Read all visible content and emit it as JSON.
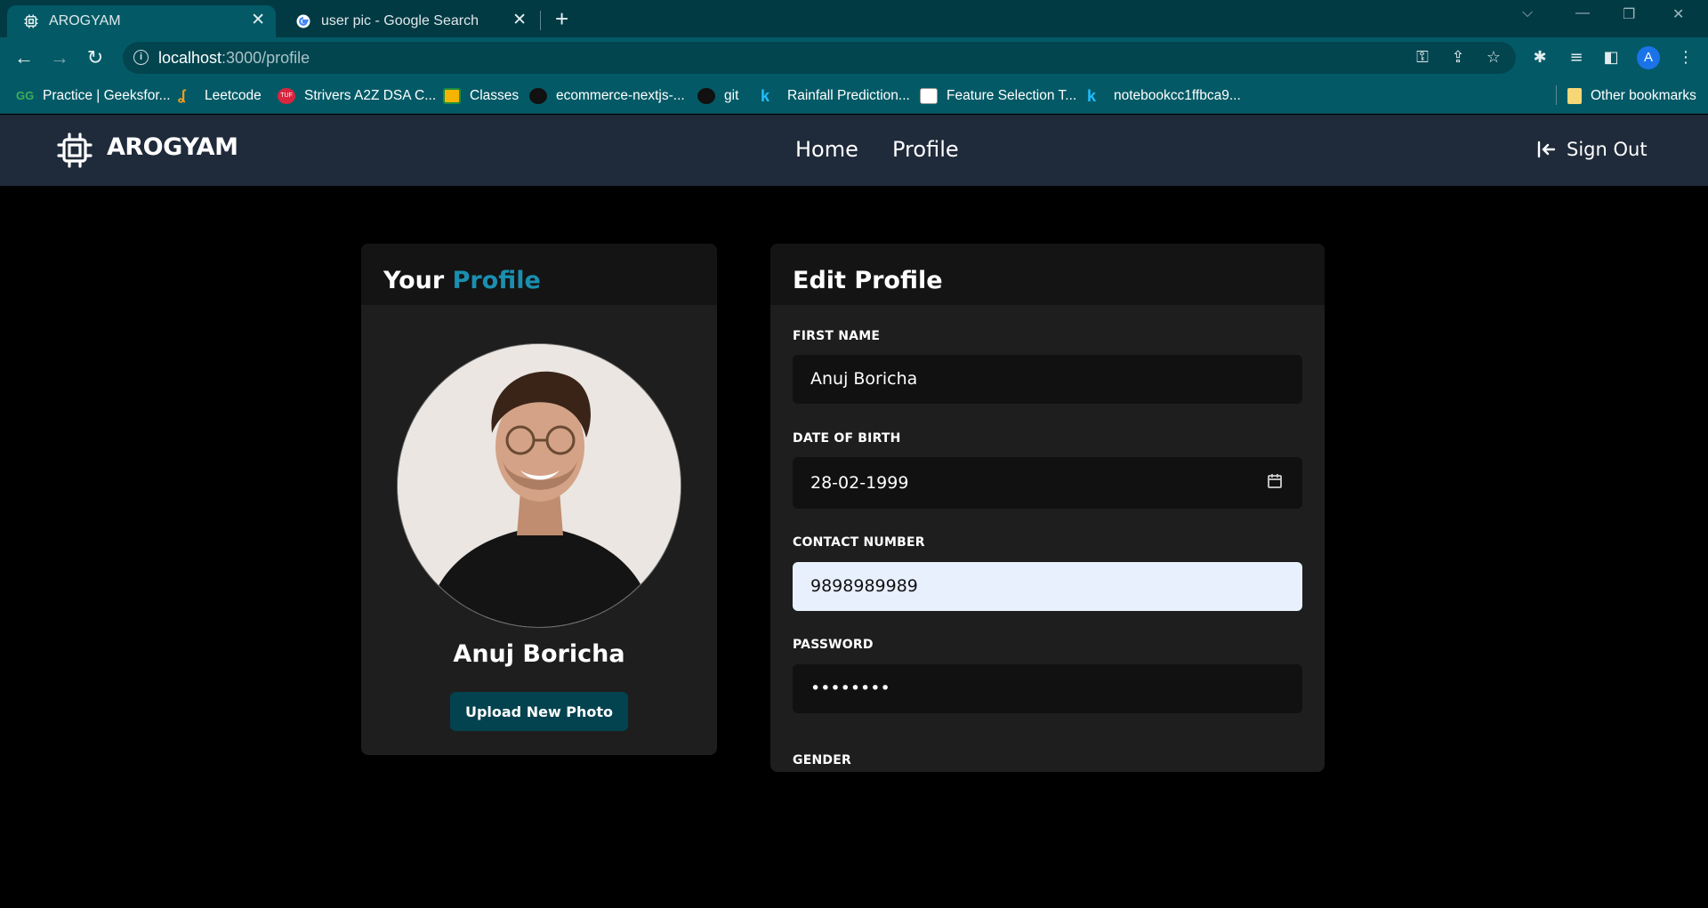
{
  "browser": {
    "tabs": [
      {
        "title": "AROGYAM",
        "active": true
      },
      {
        "title": "user pic - Google Search",
        "active": false
      }
    ],
    "url_host": "localhost",
    "url_path": ":3000/profile",
    "profile_initial": "A",
    "bookmarks": [
      {
        "label": "Practice | Geeksfor...",
        "icon": "geeksforgeeks-icon",
        "color": "#2f8d46"
      },
      {
        "label": "Leetcode",
        "icon": "leetcode-icon",
        "color": "#f89f1b"
      },
      {
        "label": "Strivers A2Z DSA C...",
        "icon": "tuf-icon",
        "color": "#d7263d"
      },
      {
        "label": "Classes",
        "icon": "google-classroom-icon",
        "color": "#f4b400"
      },
      {
        "label": "ecommerce-nextjs-...",
        "icon": "github-icon",
        "color": "#111111"
      },
      {
        "label": "git",
        "icon": "github-icon",
        "color": "#111111"
      },
      {
        "label": "Rainfall Prediction...",
        "icon": "kaggle-icon",
        "color": "#20beff"
      },
      {
        "label": "Feature Selection T...",
        "icon": "chart-icon",
        "color": "#ffffff"
      },
      {
        "label": "notebookcc1ffbca9...",
        "icon": "kaggle-icon",
        "color": "#20beff"
      }
    ],
    "other_bookmarks": "Other bookmarks"
  },
  "app": {
    "brand": "AROGYAM",
    "nav": {
      "home": "Home",
      "profile": "Profile"
    },
    "sign_out": "Sign Out"
  },
  "profile_card": {
    "title_prefix": "Your",
    "title_accent": "Profile",
    "name": "Anuj Boricha",
    "upload_label": "Upload New Photo"
  },
  "edit_card": {
    "title": "Edit Profile",
    "fields": {
      "first_name": {
        "label": "FIRST NAME",
        "value": "Anuj Boricha"
      },
      "dob": {
        "label": "DATE OF BIRTH",
        "value": "28-02-1999"
      },
      "contact": {
        "label": "CONTACT NUMBER",
        "value": "9898989989"
      },
      "password": {
        "label": "PASSWORD",
        "value": "••••••••"
      },
      "gender": {
        "label": "GENDER"
      }
    }
  },
  "colors": {
    "accent": "#1a8fb0",
    "nav_bg": "#1f2a3a",
    "button_bg": "#03424f",
    "autofill_bg": "#e8f0fe"
  }
}
